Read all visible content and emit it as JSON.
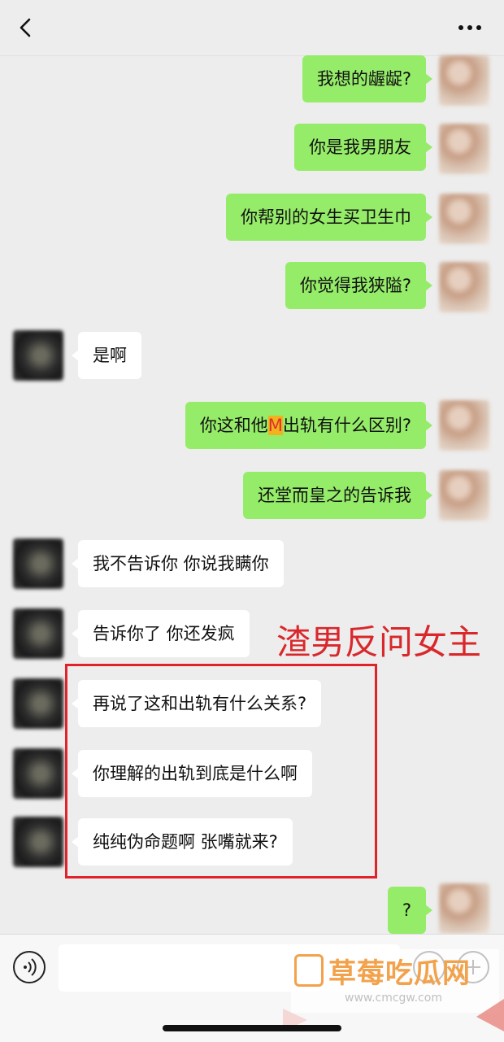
{
  "header": {
    "title": "",
    "back_icon": "chevron-left-icon",
    "more_icon": "ellipsis-icon"
  },
  "messages": [
    {
      "side": "sent",
      "text": "我想的龌龊?"
    },
    {
      "side": "sent",
      "text": "你是我男朋友"
    },
    {
      "side": "sent",
      "text": "你帮别的女生买卫生巾"
    },
    {
      "side": "sent",
      "text": "你觉得我狭隘?"
    },
    {
      "side": "recv",
      "text": "是啊"
    },
    {
      "side": "sent",
      "text_before": "你这和他",
      "text_mark": "M",
      "text_after": "出轨有什么区别?"
    },
    {
      "side": "sent",
      "text": "还堂而皇之的告诉我"
    },
    {
      "side": "recv",
      "text": "我不告诉你 你说我瞒你"
    },
    {
      "side": "recv",
      "text": "告诉你了 你还发疯"
    },
    {
      "side": "recv",
      "text": "再说了这和出轨有什么关系?"
    },
    {
      "side": "recv",
      "text": "你理解的出轨到底是什么啊"
    },
    {
      "side": "recv",
      "text": "纯纯伪命题啊 张嘴就来?"
    },
    {
      "side": "sent",
      "text": "?"
    }
  ],
  "annotation": {
    "text": "渣男反问女主",
    "color": "#d9282c"
  },
  "input_bar": {
    "voice_icon": "voice-icon",
    "emoji_icon": "emoji-icon",
    "plus_icon": "plus-icon"
  },
  "watermark": {
    "text": "草莓吃瓜网",
    "url": "www.cmcgw.com"
  },
  "colors": {
    "sent_bubble": "#95ec69",
    "recv_bubble": "#ffffff",
    "background": "#ededed"
  }
}
